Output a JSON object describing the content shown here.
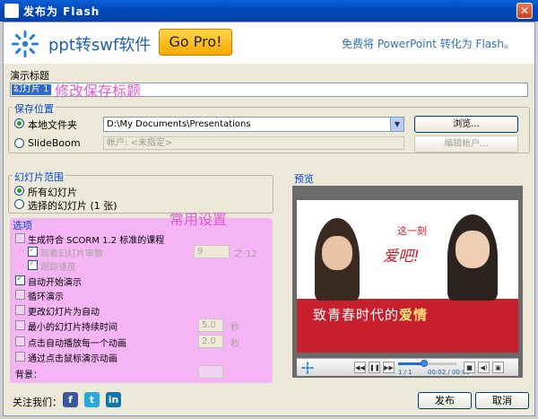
{
  "window": {
    "title": "发布为 Flash",
    "close_glyph": "✕"
  },
  "header": {
    "brand": "ppt转swf软件",
    "gopro_label": "Go Pro!",
    "tagline": "免费将 PowerPoint 转化为 Flash。"
  },
  "presentation_title": {
    "label": "演示标题",
    "value": "幻灯片 1",
    "hint": "修改保存标题"
  },
  "save_location": {
    "legend": "保存位置",
    "local_label": "本地文件夹",
    "local_path": "D:\\My Documents\\Presentations",
    "browse_label": "浏览...",
    "slideboom_label": "SlideBoom",
    "account_placeholder": "帐户: <未指定>",
    "edit_account_label": "编辑帐户..."
  },
  "slide_range": {
    "legend": "幻灯片范围",
    "all_label": "所有幻灯片",
    "selected_label": "选择的幻灯片 (1 张)"
  },
  "options": {
    "legend": "选项",
    "hint": "常用设置",
    "scorm": "生成符合 SCORM 1.2 标准的课程",
    "viewed_rate": "观看幻灯片审数",
    "viewed_value": "9",
    "viewed_of": "之 12",
    "track_speed": "跟踪速度",
    "auto_start": "自动开始演示",
    "loop": "循环演示",
    "auto_change": "更改幻灯片为自动",
    "min_duration": "最小的幻灯片持续时间",
    "min_duration_value": "5.0",
    "seconds_unit": "秒",
    "auto_anim": "点击自动播放每一个动画",
    "auto_anim_value": "2.0",
    "mouse_click": "通过点击鼠标演示动画",
    "background_label": "背景："
  },
  "preview": {
    "label": "预览",
    "slide_caption_1": "致青春时代的",
    "slide_caption_2": "爱情",
    "slide_side_text": "这一刻",
    "slide_script": "爱吧!",
    "slide_counter": "1 / 1",
    "time_readout": "00:02 / 00:05",
    "progress": 0.45
  },
  "footer": {
    "follow_label": "关注我们：",
    "facebook": "f",
    "twitter": "t",
    "linkedin": "in",
    "publish_label": "发布",
    "cancel_label": "取消"
  },
  "colors": {
    "accent": "#0046d5",
    "highlight_pink": "#f5b5f5",
    "hint_pink": "#e05ad2",
    "gopro": "#f6a800"
  }
}
